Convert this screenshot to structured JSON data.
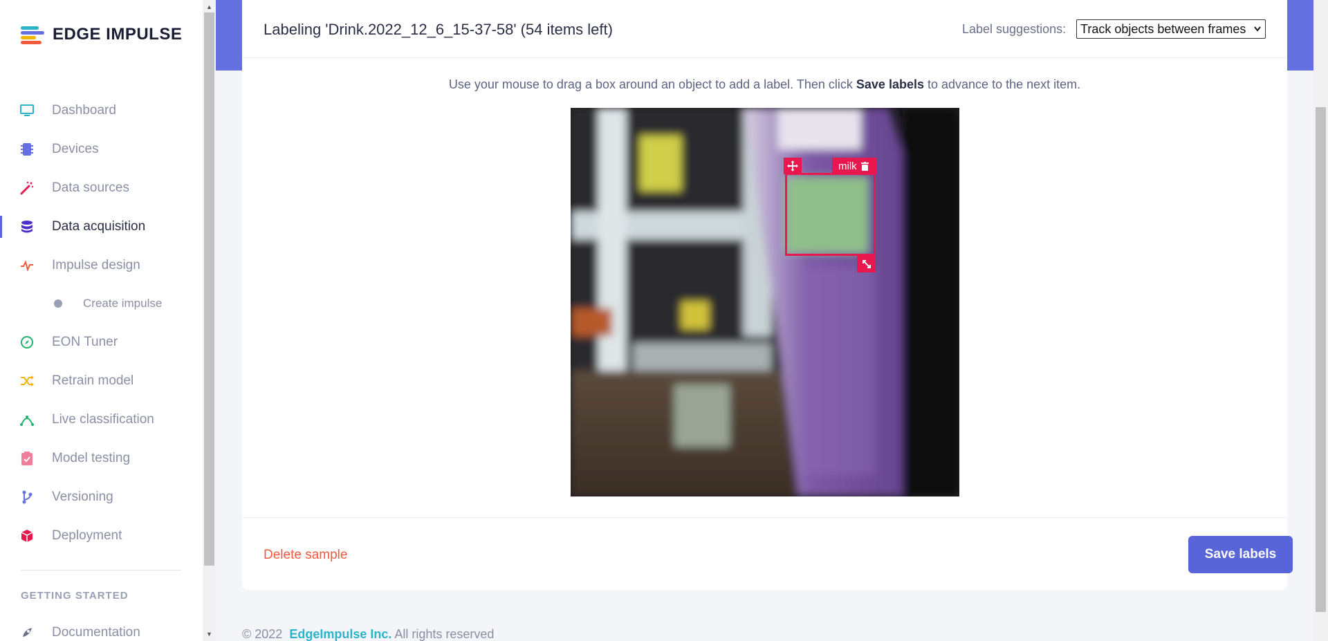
{
  "brand": {
    "name": "EDGE IMPULSE"
  },
  "sidebar": {
    "items": [
      {
        "label": "Dashboard",
        "icon": "monitor-icon",
        "color": "#2ab3c9"
      },
      {
        "label": "Devices",
        "icon": "chip-icon",
        "color": "#6470df"
      },
      {
        "label": "Data sources",
        "icon": "magic-wand-icon",
        "color": "#e8184e"
      },
      {
        "label": "Data acquisition",
        "icon": "database-icon",
        "color": "#4b2fc9"
      },
      {
        "label": "Impulse design",
        "icon": "pulse-icon",
        "color": "#f25a3b"
      },
      {
        "label": "Create impulse",
        "icon": "dot-icon",
        "color": "#9aa0b4"
      },
      {
        "label": "EON Tuner",
        "icon": "compass-icon",
        "color": "#20b26b"
      },
      {
        "label": "Retrain model",
        "icon": "shuffle-icon",
        "color": "#f2b705"
      },
      {
        "label": "Live classification",
        "icon": "network-icon",
        "color": "#20b26b"
      },
      {
        "label": "Model testing",
        "icon": "clipboard-check-icon",
        "color": "#f07d9a"
      },
      {
        "label": "Versioning",
        "icon": "branch-icon",
        "color": "#6470df"
      },
      {
        "label": "Deployment",
        "icon": "cube-icon",
        "color": "#e8184e"
      }
    ],
    "section_title": "GETTING STARTED",
    "section_items": [
      {
        "label": "Documentation",
        "icon": "rocket-icon"
      }
    ]
  },
  "labeling": {
    "title": "Labeling 'Drink.2022_12_6_15-37-58' (54 items left)",
    "suggestions_label": "Label suggestions:",
    "suggestions_value": "Track objects between frames",
    "instruction_pre": "Use your mouse to drag a box around an object to add a label. Then click",
    "instruction_bold": "Save labels",
    "instruction_post": "to advance to the next item.",
    "box_label": "milk",
    "delete_label": "Delete sample",
    "save_label": "Save labels"
  },
  "footer": {
    "copyright": "© 2022",
    "company": "EdgeImpulse Inc.",
    "rights": "All rights reserved"
  },
  "colors": {
    "accent": "#5865d9",
    "hero": "#6470df",
    "bbox": "#e8184e",
    "danger": "#f25a3b"
  }
}
